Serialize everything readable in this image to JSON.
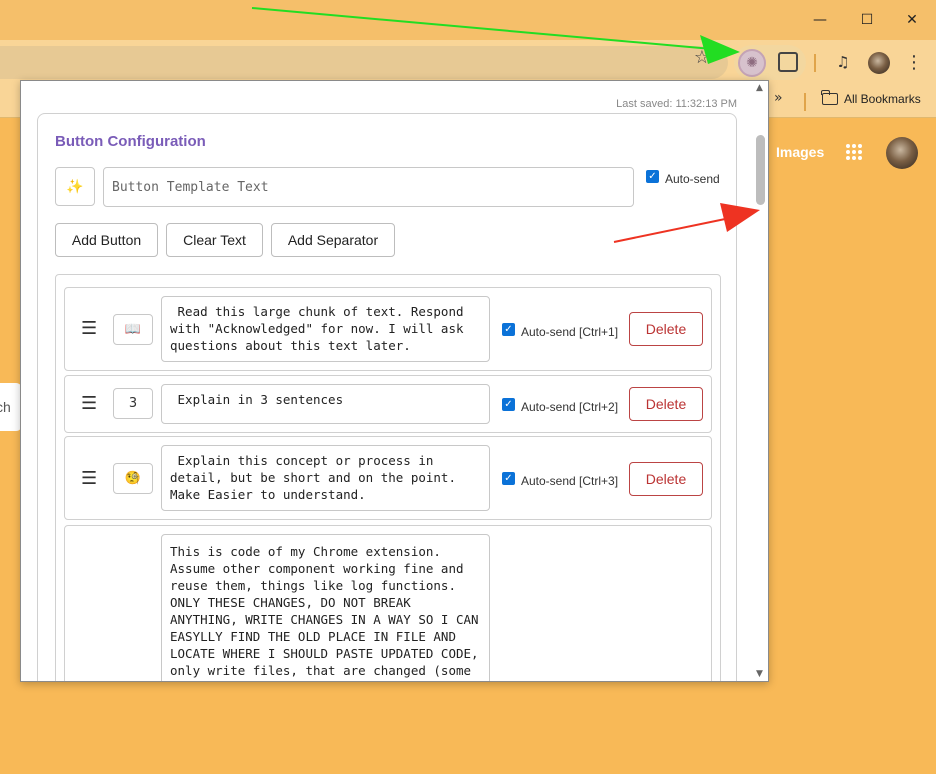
{
  "browser": {
    "window_controls": {
      "minimize": "—",
      "maximize": "☐",
      "close": "✕"
    },
    "toolbar": {
      "bookmark_star": "☆",
      "extension_icon": "brain-icon",
      "menu_glyph": "⋮"
    },
    "bookmarks_bar": {
      "overflow": "»",
      "all_bookmarks_label": "All Bookmarks"
    }
  },
  "google_page": {
    "images_link": "Images",
    "search_partial": "ch G"
  },
  "popup": {
    "last_saved": "Last saved: 11:32:13 PM",
    "title": "Button Configuration",
    "new_button": {
      "emoji": "✨",
      "placeholder": "Button Template Text",
      "autosend_label": "Auto-send",
      "autosend_checked": true
    },
    "actions": {
      "add_button": "Add Button",
      "clear_text": "Clear Text",
      "add_separator": "Add Separator"
    },
    "buttons": [
      {
        "handle": "☰",
        "icon": "📖",
        "text": " Read this large chunk of text. Respond with \"Acknowledged\" for now. I will ask questions about this text later.",
        "autosend_label": "Auto-send [Ctrl+1]",
        "delete_label": "Delete"
      },
      {
        "handle": "☰",
        "icon": "3",
        "text": " Explain in 3 sentences",
        "autosend_label": "Auto-send [Ctrl+2]",
        "delete_label": "Delete"
      },
      {
        "handle": "☰",
        "icon": "🧐",
        "text": " Explain this concept or process in detail, but be short and on the point. Make Easier to understand.",
        "autosend_label": "Auto-send [Ctrl+3]",
        "delete_label": "Delete"
      },
      {
        "text": "This is code of my Chrome extension. Assume other component working fine and reuse them, things like log functions. ONLY THESE CHANGES, DO NOT BREAK ANYTHING, WRITE CHANGES IN A WAY SO I CAN EASYLLY FIND THE OLD PLACE IN FILE AND LOCATE WHERE I SHOULD PASTE UPDATED CODE, only write files, that are changed (some files are provided for reference"
      }
    ]
  },
  "colors": {
    "page_background": "#f8b957",
    "title_purple": "#7a5cb8",
    "delete_red": "#b33333",
    "checkbox_blue": "#0b72d8",
    "arrow_green": "#22dd22",
    "arrow_red": "#ee3322"
  }
}
